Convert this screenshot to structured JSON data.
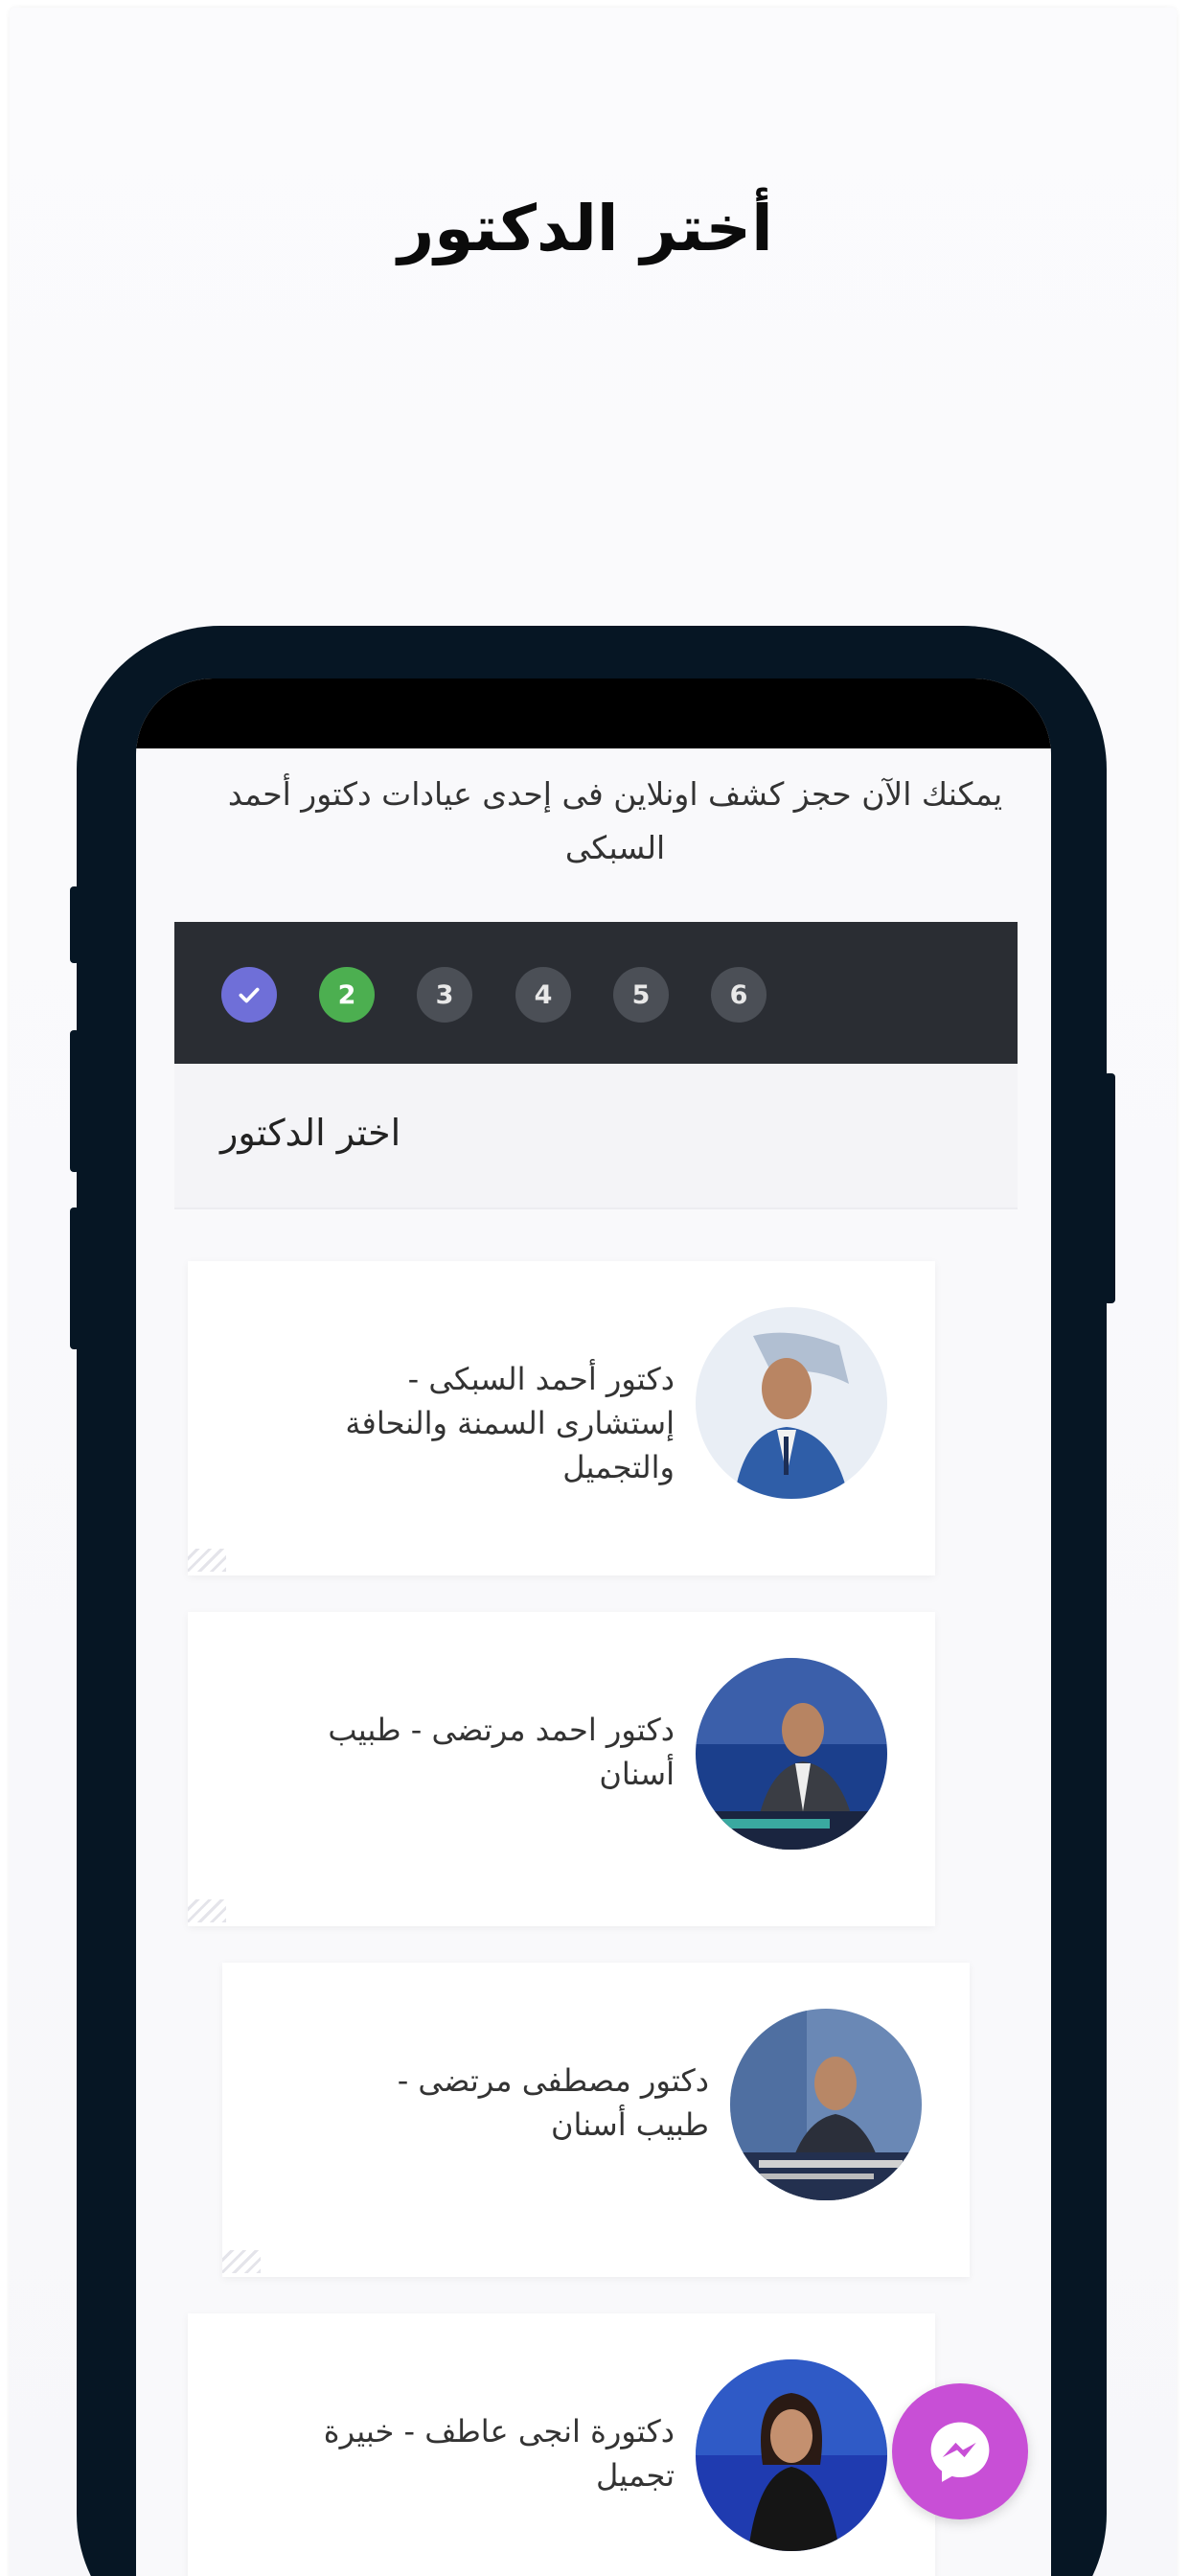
{
  "header": {
    "title": "أختر الدكتور"
  },
  "screen": {
    "intro": "يمكنك الآن حجز كشف اونلاين فى إحدى عيادات دكتور أحمد السبكى",
    "steps": [
      {
        "label": "✓",
        "state": "done"
      },
      {
        "label": "2",
        "state": "active"
      },
      {
        "label": "3",
        "state": "todo"
      },
      {
        "label": "4",
        "state": "todo"
      },
      {
        "label": "5",
        "state": "todo"
      },
      {
        "label": "6",
        "state": "todo"
      }
    ],
    "section_title": "اختر الدكتور",
    "doctors": [
      {
        "name": "دكتور أحمد السبكى - إستشارى السمنة والنحافة والتجميل"
      },
      {
        "name": "دكتور احمد مرتضى - طبيب أسنان"
      },
      {
        "name": "دكتور مصطفى مرتضى - طبيب أسنان"
      },
      {
        "name": "دكتورة انجى عاطف - خبيرة تجميل"
      }
    ]
  },
  "messenger": {
    "icon": "messenger-icon"
  },
  "colors": {
    "step_done": "#6f6fd8",
    "step_active": "#4caf50",
    "step_todo": "#4b4f56",
    "stepbar_bg": "#2a2d33",
    "phone_frame": "#061624",
    "messenger": "#c84fd6"
  }
}
